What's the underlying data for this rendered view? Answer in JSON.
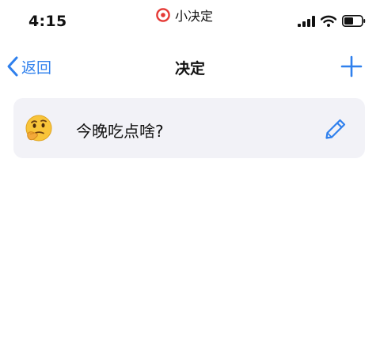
{
  "status_bar": {
    "time": "4:15",
    "app_indicator": "小决定",
    "icons": [
      "cellular-signal-icon",
      "wifi-icon",
      "battery-icon"
    ]
  },
  "nav": {
    "back_label": "返回",
    "title": "决定",
    "back_icon": "chevron-left-icon",
    "add_icon": "plus-icon"
  },
  "decisions": [
    {
      "text": "今晚吃点啥?",
      "icon": "thinking-face-icon",
      "edit_icon": "pencil-icon"
    }
  ],
  "colors": {
    "accent": "#2f80ed",
    "card_background": "#f2f2f7",
    "indicator_red": "#e53935"
  }
}
